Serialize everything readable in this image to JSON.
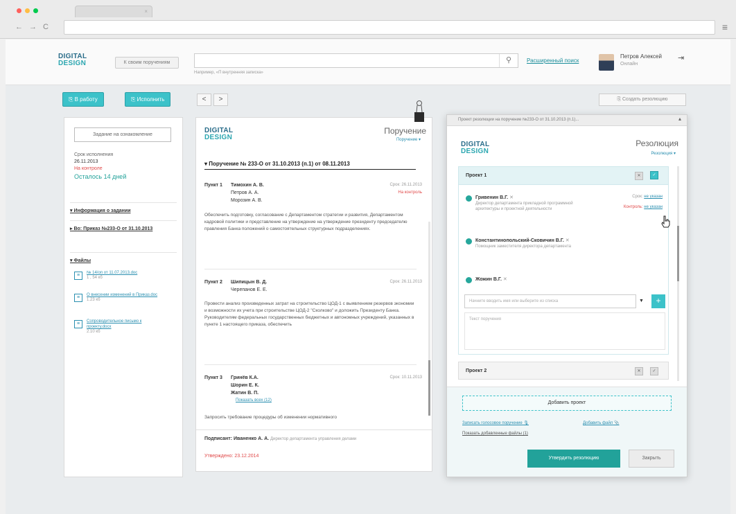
{
  "browser": {
    "dot_colors": [
      "#ff605c",
      "#ffbd44",
      "#00ca4e"
    ],
    "tab_close": "×",
    "back": "←",
    "forward": "→",
    "reload": "C",
    "menu": "≡"
  },
  "header": {
    "logo_line1": "DIGITAL",
    "logo_line2": "DESIGN",
    "tasks_button": "К своим поручениям",
    "search_hint": "Например, «П внутренняя записка»",
    "search_icon": "⚲",
    "advanced_search": "Расширенный поиск",
    "user_name": "Петров Алексей",
    "user_status": "Онлайн",
    "logout_icon": "⇥"
  },
  "toolbar": {
    "to_work": "В работу",
    "execute": "Исполнить",
    "prev": "<",
    "next": ">",
    "create_resolution": "Создать резолюцию"
  },
  "left_panel": {
    "task_button": "Задание на ознакомление",
    "due_label": "Срок исполнения",
    "due_date": "26.11.2013",
    "control": "На контроле",
    "remaining": "Осталось 14 дней",
    "section_info": "Информация о задании",
    "section_order": "Во: Приказ №233-О от 31.10.2013",
    "section_files": "Файлы",
    "files": [
      {
        "name": "№ 14/оп от 11.07.2013.doc",
        "size": "1 , 54 кб"
      },
      {
        "name": "О внесении изменений в Приказ.doc",
        "size": "1.23 кб"
      },
      {
        "name": "Сопроводительное письмо к проекту.docx",
        "size": "2.10 кб"
      }
    ]
  },
  "doc": {
    "type": "Поручение",
    "type_sub": "Поручение ▾",
    "title": "▾ Поручение № 233-О от 31.10.2013 (п.1) от 08.11.2013",
    "points": [
      {
        "label": "Пункт 1",
        "persons": [
          "Тимохин А. В.",
          "Петров А. А.",
          "Морозин А. В."
        ],
        "due": "Срок: 26.11.2013",
        "status": "На контроль",
        "body": "Обеспечить подготовку, согласование с Департаментом стратегии и развития, Департаментом кадровой политики и представление на утверждение на утверждение президенту председателю правления Банка положений о самостоятельных структурных подразделениях."
      },
      {
        "label": "Пункт 2",
        "persons": [
          "Шипицын В. Д.",
          "Черепанов Е. Е."
        ],
        "due": "Срок: 26.11.2013",
        "body": "Провести анализ произведенных затрат на строительство ЦОД-1 с выявлением резервов экономии и возможности их учета при строительстве ЦОД-2 \"Сколково\" и доложить Президенту Банка. Руководителям федеральных государственных бюджетных и автономных учреждений, указанных в пункте 1 настоящего приказа, обеспечить"
      },
      {
        "label": "Пункт 3",
        "persons": [
          "Гринёв К.А.",
          "Шорин Е. К.",
          "Жатин В. П."
        ],
        "due": "Срок: 10.11.2013",
        "more": "Показать всех (12)",
        "body": "Запросить требование процедуры об изменении нормативного"
      }
    ],
    "signer_label": "Подписант:",
    "signer": "Иваненко А. А.",
    "signer_role": "Директор департамента управления делами",
    "approved": "Утверждено: 23.12.2014"
  },
  "resolution": {
    "header": "Проект резолюции на поручение №233-О от 31.10.2013 (п.1)...",
    "collapse": "▴",
    "type": "Резолюция",
    "type_sub": "Резолюция ▾",
    "project1": {
      "title": "Проект 1",
      "btn_delete": "✕",
      "btn_save": "✓",
      "executors": [
        {
          "name": "Гривенин В.Г.",
          "x": "✕",
          "sub": "Директор департамента прикладной программной архитектуры и проектной деятельности",
          "due_label": "Срок:",
          "due": "не указан",
          "ctrl_label": "Контроль:",
          "ctrl": "не указан"
        },
        {
          "name": "Константинопольский-Сковичин В.Г.",
          "x": "✕",
          "sub": "Помощник заместителя директора департамента"
        },
        {
          "name": "Жожин В.Г.",
          "x": "✕",
          "sub": ""
        }
      ],
      "executor_placeholder": "Начните вводить имя или выберите из списка",
      "executor_arrow": "▼",
      "executor_add": "+",
      "text_placeholder": "Текст поручения"
    },
    "project2": {
      "title": "Проект 2",
      "btn_delete": "✕",
      "btn_save": "✓"
    },
    "add_project": "Добавить проект",
    "link_voice": "Записать голосовое поручение",
    "link_voice_icon": "🎙",
    "link_file": "Добавить файл",
    "link_file_icon": "📎",
    "link_show_files": "Показать добавленные файлы (1)",
    "approve": "Утвердить резолюцию",
    "close": "Закрыть"
  }
}
